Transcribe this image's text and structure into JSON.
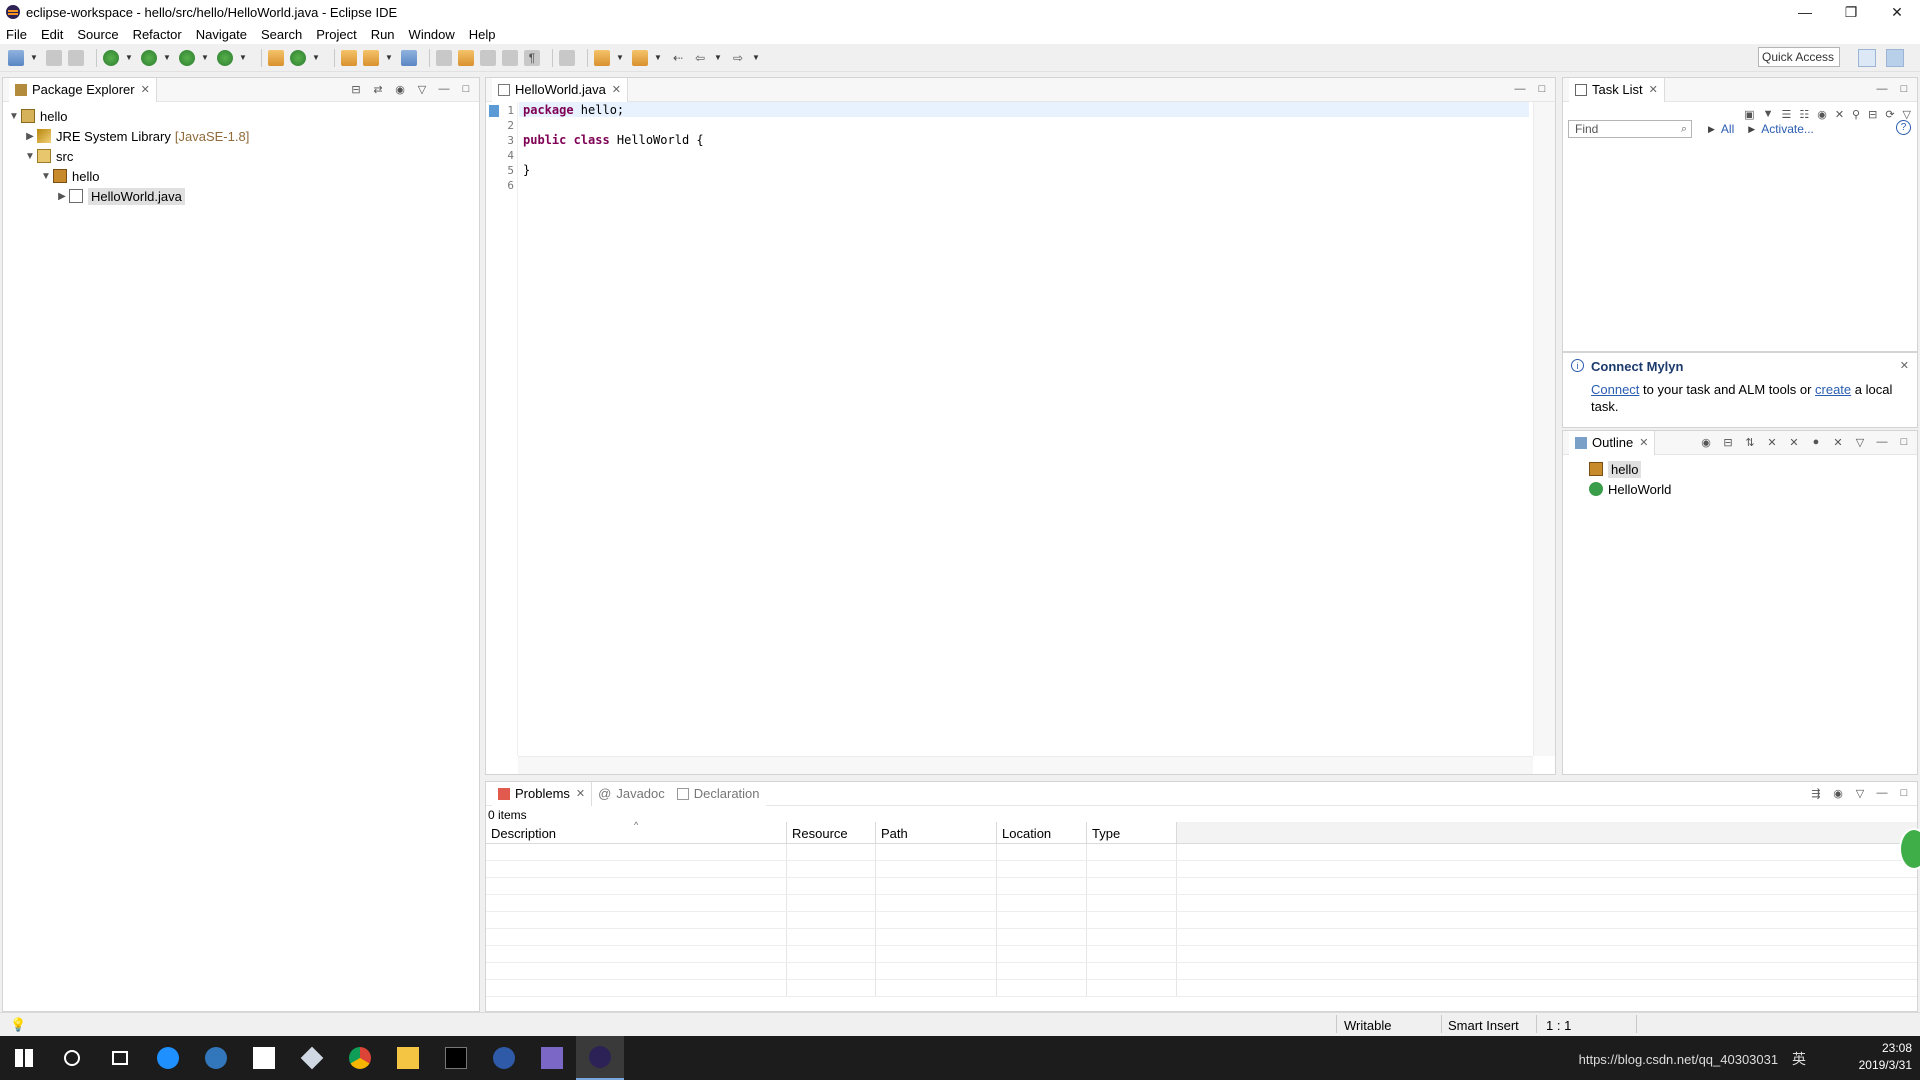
{
  "window": {
    "title": "eclipse-workspace - hello/src/hello/HelloWorld.java - Eclipse IDE",
    "minimize": "—",
    "restore": "❐",
    "close": "✕"
  },
  "menu": [
    "File",
    "Edit",
    "Source",
    "Refactor",
    "Navigate",
    "Search",
    "Project",
    "Run",
    "Window",
    "Help"
  ],
  "toolbar": {
    "quick_access": "Quick Access"
  },
  "package_explorer": {
    "title": "Package Explorer",
    "tree": {
      "project": "hello",
      "jre": "JRE System Library",
      "jre_version": "[JavaSE-1.8]",
      "src": "src",
      "package": "hello",
      "file": "HelloWorld.java"
    }
  },
  "editor": {
    "tab": "HelloWorld.java",
    "lines": [
      {
        "no": "1",
        "kw": "package",
        "rest": " hello;"
      },
      {
        "no": "2",
        "kw": "",
        "rest": ""
      },
      {
        "no": "3",
        "kw": "public class",
        "rest": " HelloWorld {"
      },
      {
        "no": "4",
        "kw": "",
        "rest": ""
      },
      {
        "no": "5",
        "kw": "",
        "rest": "}"
      },
      {
        "no": "6",
        "kw": "",
        "rest": ""
      }
    ]
  },
  "task_list": {
    "title": "Task List",
    "find_placeholder": "Find",
    "all": "All",
    "activate": "Activate...",
    "help": "?"
  },
  "mylyn": {
    "title": "Connect Mylyn",
    "connect": "Connect",
    "text1": " to your task and ALM tools or ",
    "create": "create",
    "text2": " a local task."
  },
  "outline": {
    "title": "Outline",
    "items": [
      "hello",
      "HelloWorld"
    ]
  },
  "bottom_panel": {
    "tabs": [
      "Problems",
      "Javadoc",
      "Declaration"
    ],
    "items_count": "0 items",
    "columns": [
      "Description",
      "Resource",
      "Path",
      "Location",
      "Type"
    ]
  },
  "status": {
    "writable": "Writable",
    "insert_mode": "Smart Insert",
    "position": "1 : 1"
  },
  "taskbar": {
    "time": "23:08",
    "date": "2019/3/31",
    "watermark": "https://blog.csdn.net/qq_40303031",
    "ime": "英"
  },
  "colors": {
    "keyword": "#7f0055",
    "link": "#2a5db0",
    "selection": "#e0e0e0"
  }
}
